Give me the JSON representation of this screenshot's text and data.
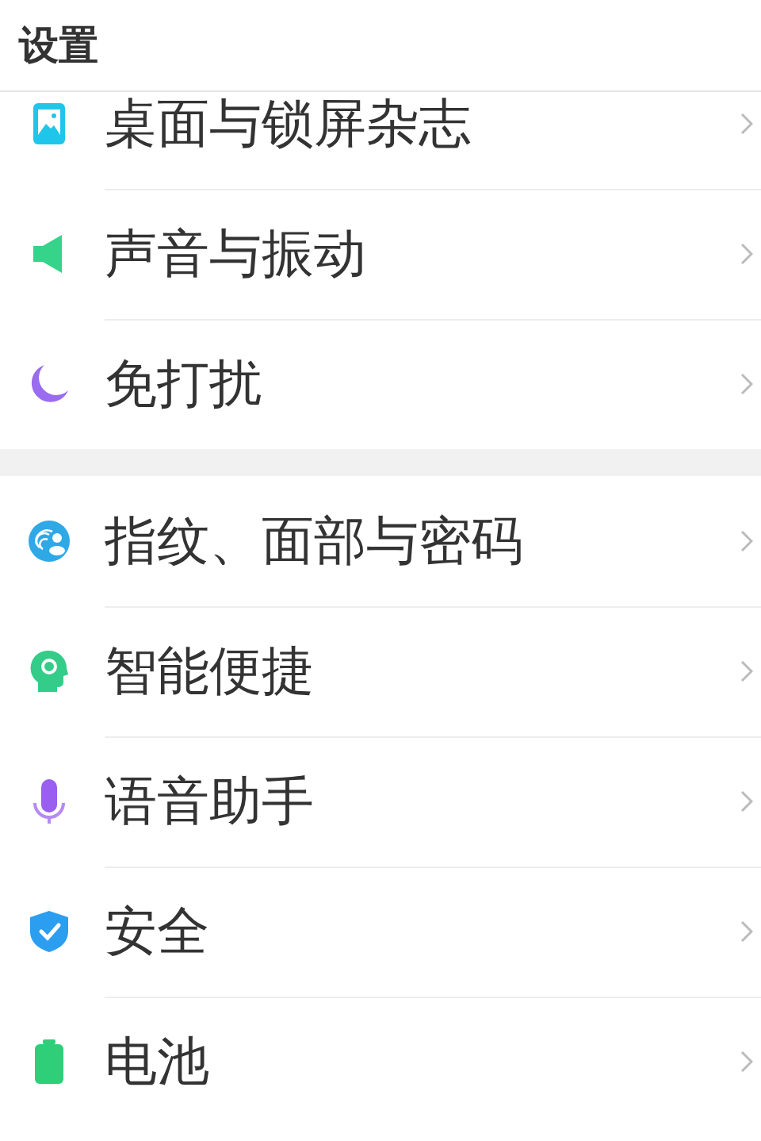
{
  "header": {
    "title": "设置"
  },
  "sections": [
    {
      "items": [
        {
          "label": "桌面与锁屏杂志"
        },
        {
          "label": "声音与振动"
        },
        {
          "label": "免打扰"
        }
      ]
    },
    {
      "items": [
        {
          "label": "指纹、面部与密码"
        },
        {
          "label": "智能便捷"
        },
        {
          "label": "语音助手"
        },
        {
          "label": "安全"
        },
        {
          "label": "电池"
        }
      ]
    }
  ]
}
